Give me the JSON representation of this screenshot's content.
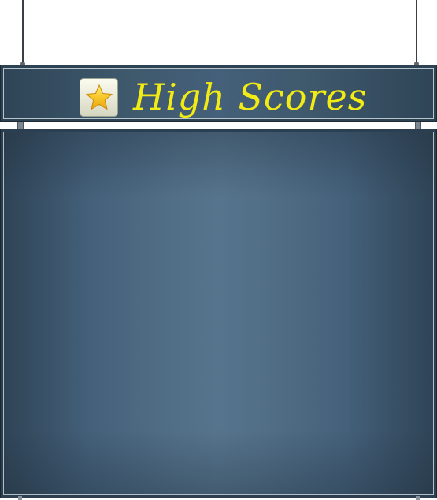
{
  "header": {
    "title": "High Scores",
    "icon": "star-icon",
    "title_color": "#f2ec14"
  },
  "colors": {
    "board_base": "#2b3f50",
    "board_highlight": "#56748d",
    "frame_border": "#b3bfc8",
    "star_fill": "#f5c623"
  },
  "scores": []
}
